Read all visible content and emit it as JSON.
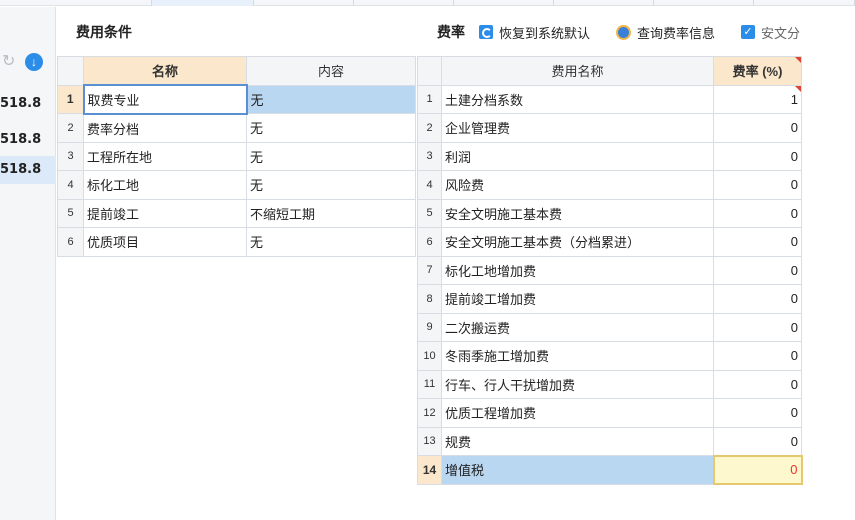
{
  "left_sidebar": {
    "values": [
      "518.8",
      "518.8",
      "518.8"
    ],
    "selected_index": 2
  },
  "conditions": {
    "title": "费用条件",
    "headers": {
      "name": "名称",
      "content": "内容"
    },
    "rows": [
      {
        "idx": "1",
        "name": "取费专业",
        "content": "无"
      },
      {
        "idx": "2",
        "name": "费率分档",
        "content": "无"
      },
      {
        "idx": "3",
        "name": "工程所在地",
        "content": "无"
      },
      {
        "idx": "4",
        "name": "标化工地",
        "content": "无"
      },
      {
        "idx": "5",
        "name": "提前竣工",
        "content": "不缩短工期"
      },
      {
        "idx": "6",
        "name": "优质项目",
        "content": "无"
      }
    ]
  },
  "rates": {
    "title": "费率",
    "restore_label": "恢复到系统默认",
    "query_label": "查询费率信息",
    "checkbox_label": "安文分",
    "headers": {
      "name": "费用名称",
      "rate": "费率 (%)"
    },
    "rows": [
      {
        "idx": "1",
        "name": "土建分档系数",
        "rate": "1"
      },
      {
        "idx": "2",
        "name": "企业管理费",
        "rate": "0"
      },
      {
        "idx": "3",
        "name": "利润",
        "rate": "0"
      },
      {
        "idx": "4",
        "name": "风险费",
        "rate": "0"
      },
      {
        "idx": "5",
        "name": "安全文明施工基本费",
        "rate": "0"
      },
      {
        "idx": "6",
        "name": "安全文明施工基本费（分档累进）",
        "rate": "0"
      },
      {
        "idx": "7",
        "name": "标化工地增加费",
        "rate": "0"
      },
      {
        "idx": "8",
        "name": "提前竣工增加费",
        "rate": "0"
      },
      {
        "idx": "9",
        "name": "二次搬运费",
        "rate": "0"
      },
      {
        "idx": "10",
        "name": "冬雨季施工增加费",
        "rate": "0"
      },
      {
        "idx": "11",
        "name": "行车、行人干扰增加费",
        "rate": "0"
      },
      {
        "idx": "12",
        "name": "优质工程增加费",
        "rate": "0"
      },
      {
        "idx": "13",
        "name": "规费",
        "rate": "0"
      },
      {
        "idx": "14",
        "name": "增值税",
        "rate": "0"
      }
    ]
  },
  "colors": {
    "accent": "#2b8de8",
    "selection": "#bad7f2",
    "header_highlight": "#fbe7cb",
    "edit_cell": "#fdf8cd"
  }
}
